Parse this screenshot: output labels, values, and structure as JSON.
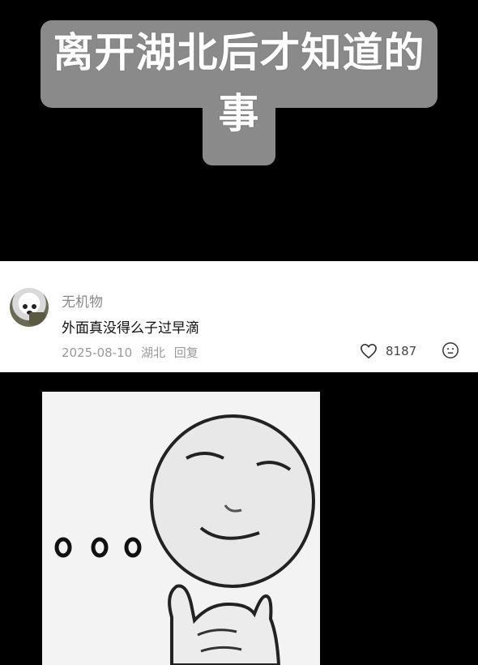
{
  "title": {
    "line1": "离开湖北后才知道的",
    "line2": "事"
  },
  "comment": {
    "username": "无机物",
    "text": "外面真没得么子过早滴",
    "date": "2025-08-10",
    "location": "湖北",
    "reply_label": "回复",
    "like_count": "8187",
    "icons": [
      "heart-icon",
      "dislike-face-icon"
    ]
  },
  "image": {
    "description_icon": "meme-face-thinking-icon"
  }
}
